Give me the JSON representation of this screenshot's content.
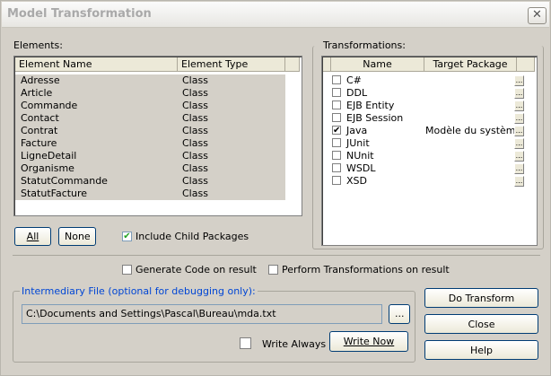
{
  "window": {
    "title": "Model Transformation"
  },
  "elements": {
    "label": "Elements:",
    "columns": [
      "Element Name",
      "Element Type"
    ],
    "rows": [
      {
        "name": "Adresse",
        "type": "Class"
      },
      {
        "name": "Article",
        "type": "Class"
      },
      {
        "name": "Commande",
        "type": "Class"
      },
      {
        "name": "Contact",
        "type": "Class"
      },
      {
        "name": "Contrat",
        "type": "Class"
      },
      {
        "name": "Facture",
        "type": "Class"
      },
      {
        "name": "LigneDetail",
        "type": "Class"
      },
      {
        "name": "Organisme",
        "type": "Class"
      },
      {
        "name": "StatutCommande",
        "type": "Class"
      },
      {
        "name": "StatutFacture",
        "type": "Class"
      }
    ],
    "all_button": "All",
    "none_button": "None",
    "include_child_label": "Include Child Packages",
    "include_child_checked": true
  },
  "transformations": {
    "label": "Transformations:",
    "columns": [
      "Name",
      "Target Package"
    ],
    "ellipsis": "...",
    "rows": [
      {
        "name": "C#",
        "checked": false,
        "target": ""
      },
      {
        "name": "DDL",
        "checked": false,
        "target": ""
      },
      {
        "name": "EJB Entity",
        "checked": false,
        "target": ""
      },
      {
        "name": "EJB Session",
        "checked": false,
        "target": ""
      },
      {
        "name": "Java",
        "checked": true,
        "target": "Modèle du système"
      },
      {
        "name": "JUnit",
        "checked": false,
        "target": ""
      },
      {
        "name": "NUnit",
        "checked": false,
        "target": ""
      },
      {
        "name": "WSDL",
        "checked": false,
        "target": ""
      },
      {
        "name": "XSD",
        "checked": false,
        "target": ""
      }
    ]
  },
  "options": {
    "generate_code_label": "Generate Code on result",
    "perform_transformations_label": "Perform Transformations on result"
  },
  "intermediary": {
    "label": "Intermediary File (optional for debugging only):",
    "path": "C:\\Documents and Settings\\Pascal\\Bureau\\mda.txt",
    "browse_label": "...",
    "write_always_label": "Write Always",
    "write_now_label": "Write Now"
  },
  "buttons": {
    "do_transform": "Do Transform",
    "close": "Close",
    "help": "Help"
  },
  "colors": {
    "title_text": "#a9a9a9",
    "group_label": "#0046d5",
    "check": "#21a121"
  }
}
